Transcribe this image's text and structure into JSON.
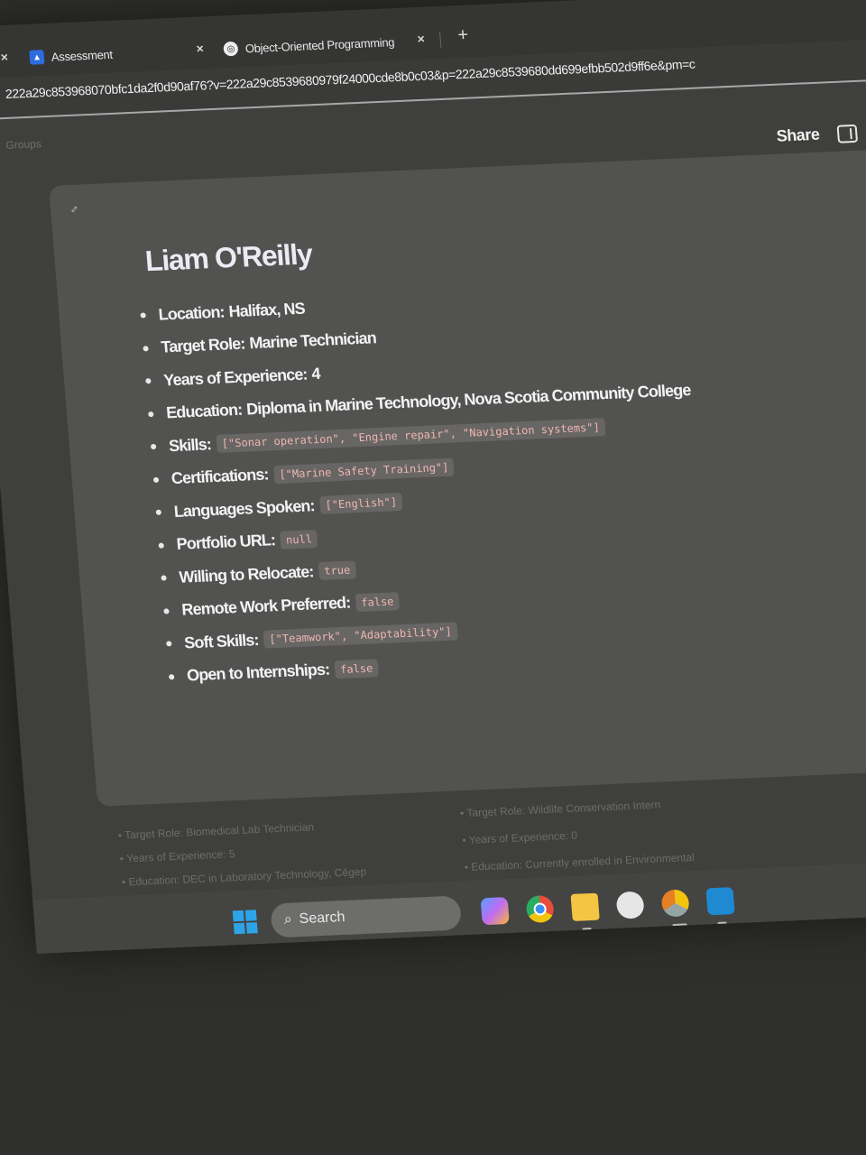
{
  "browser": {
    "tabs": [
      {
        "label": "Assessment",
        "icon": "assessment-icon"
      },
      {
        "label": "Object-Oriented Programming",
        "icon": "openai-icon"
      }
    ],
    "new_tab": "+",
    "close": "×",
    "url": "222a29c853968070bfc1da2f0d90af76?v=222a29c8539680979f24000cde8b0c03&p=222a29c8539680dd699efbb502d9ff6e&pm=c"
  },
  "page": {
    "groups_label": "Groups",
    "share_label": "Share"
  },
  "profile": {
    "name": "Liam O'Reilly",
    "fields": [
      {
        "label": "Location:",
        "value": "Halifax, NS",
        "code": ""
      },
      {
        "label": "Target Role:",
        "value": "Marine Technician",
        "code": ""
      },
      {
        "label": "Years of Experience:",
        "value": "4",
        "code": ""
      },
      {
        "label": "Education:",
        "value": "Diploma in Marine Technology, Nova Scotia Community College",
        "code": ""
      },
      {
        "label": "Skills:",
        "value": "",
        "code": "[\"Sonar operation\", \"Engine repair\", \"Navigation systems\"]"
      },
      {
        "label": "Certifications:",
        "value": "",
        "code": "[\"Marine Safety Training\"]"
      },
      {
        "label": "Languages Spoken:",
        "value": "",
        "code": "[\"English\"]"
      },
      {
        "label": "Portfolio URL:",
        "value": "",
        "code": "null"
      },
      {
        "label": "Willing to Relocate:",
        "value": "",
        "code": "true"
      },
      {
        "label": "Remote Work Preferred:",
        "value": "",
        "code": "false"
      },
      {
        "label": "Soft Skills:",
        "value": "",
        "code": "[\"Teamwork\", \"Adaptability\"]"
      },
      {
        "label": "Open to Internships:",
        "value": "",
        "code": "false"
      }
    ]
  },
  "background_cards": {
    "left": [
      "Target Role: Biomedical Lab Technician",
      "Years of Experience: 5",
      "Education: DEC in Laboratory Technology, Cégep"
    ],
    "right": [
      "Target Role: Wildlife Conservation Intern",
      "Years of Experience: 0",
      "Education: Currently enrolled in Environmental"
    ]
  },
  "taskbar": {
    "search_label": "Search"
  }
}
